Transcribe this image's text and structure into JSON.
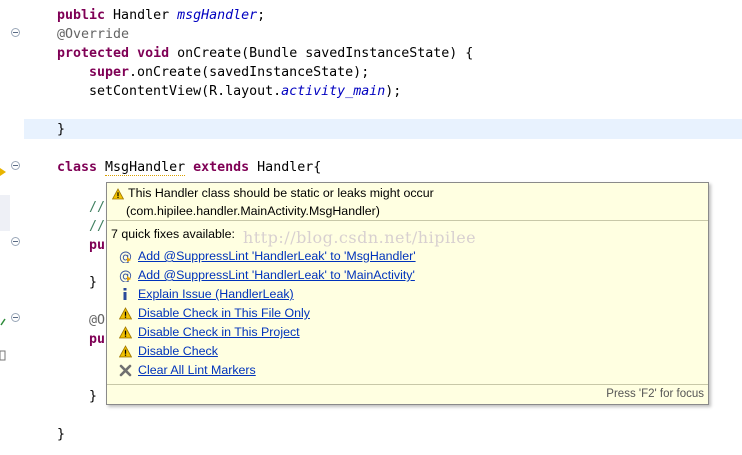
{
  "editor": {
    "lines": {
      "l1": {
        "kw": "public",
        "rest": " Handler ",
        "ital": "msgHandler",
        "end": ";"
      },
      "l2": {
        "ann": "@Override"
      },
      "l3": {
        "kw1": "protected",
        "kw2": "void",
        "rest": " onCreate(Bundle savedInstanceState) {"
      },
      "l4": {
        "kw": "super",
        "rest": ".onCreate(savedInstanceState);"
      },
      "l5": {
        "rest": "setContentView(R.layout.",
        "ital": "activity_main",
        "end": ");"
      },
      "l6": {
        "rest": "}"
      },
      "l7": {
        "kw1": "class",
        "name": "MsgHandler",
        "kw2": "extends",
        "rest": " Handler{"
      },
      "l8": {
        "rest": "//"
      },
      "l9": {
        "rest": "//"
      },
      "l10": {
        "rest": "pu"
      },
      "l11": {
        "rest": "}"
      },
      "l12": {
        "rest": "@O"
      },
      "l13": {
        "rest": "pu"
      },
      "l14": {
        "rest": "}"
      },
      "l15": {
        "rest": "}"
      }
    }
  },
  "popup": {
    "message_line1": "This Handler class should be static or leaks might occur",
    "message_line2": "(com.hipilee.handler.MainActivity.MsgHandler)",
    "fix_count": "7 quick fixes available:",
    "watermark": "http://blog.csdn.net/hipilee",
    "fixes": [
      {
        "label": "Add @SuppressLint 'HandlerLeak' to 'MsgHandler'",
        "icon": "at-annotation-icon"
      },
      {
        "label": "Add @SuppressLint 'HandlerLeak' to 'MainActivity'",
        "icon": "at-annotation-icon"
      },
      {
        "label": "Explain Issue (HandlerLeak)",
        "icon": "info-icon"
      },
      {
        "label": "Disable Check in This File Only",
        "icon": "warning-icon"
      },
      {
        "label": "Disable Check in This Project",
        "icon": "warning-icon"
      },
      {
        "label": "Disable Check",
        "icon": "warning-icon"
      },
      {
        "label": "Clear All Lint Markers",
        "icon": "clear-markers-icon"
      }
    ],
    "footer": "Press 'F2' for focus"
  },
  "colors": {
    "keyword": "#7f0055",
    "annotation": "#646464",
    "field_italic": "#0000c0",
    "popup_bg": "#ffffe1",
    "link": "#0033bb"
  }
}
